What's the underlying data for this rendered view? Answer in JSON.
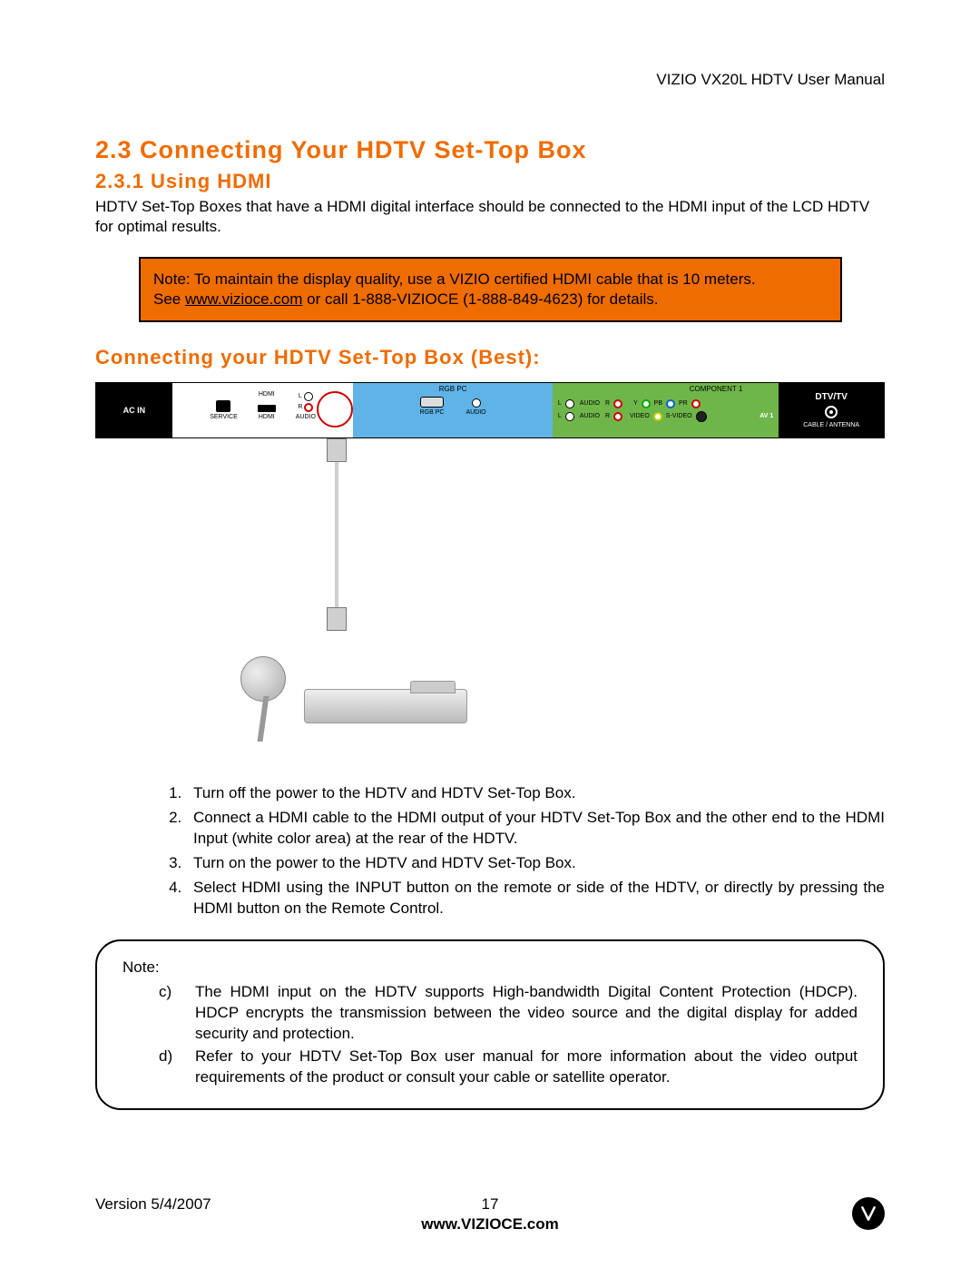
{
  "header": {
    "manual_title": "VIZIO VX20L HDTV User Manual"
  },
  "section": {
    "h1": "2.3 Connecting Your HDTV Set-Top Box",
    "h2": "2.3.1 Using HDMI",
    "intro": "HDTV Set-Top Boxes that have a HDMI digital interface should be connected to the HDMI input of the LCD HDTV for optimal results.",
    "note_box": {
      "line1": "Note: To maintain the display quality, use a VIZIO certified HDMI cable that is 10 meters.",
      "line2_pre": "See ",
      "link": "www.vizioce.com",
      "line2_post": " or call 1-888-VIZIOCE (1-888-849-4623) for details."
    },
    "h3": "Connecting your HDTV Set-Top Box (Best):"
  },
  "panel": {
    "ac_in": "AC IN",
    "service": "SERVICE",
    "hdmi_top": "HDMI",
    "hdmi_bot": "HDMI",
    "audio": "AUDIO",
    "l": "L",
    "r": "R",
    "rgb_pc_top": "RGB PC",
    "rgb_pc_bot": "RGB PC",
    "component1": "COMPONENT 1",
    "y": "Y",
    "pb": "PB",
    "pr": "PR",
    "video": "VIDEO",
    "svideo": "S-VIDEO",
    "av1": "AV 1",
    "dtvtv": "DTV/TV",
    "cable_ant": "CABLE / ANTENNA"
  },
  "steps": [
    "Turn off the power to the HDTV and HDTV Set-Top Box.",
    "Connect a HDMI cable to the HDMI output of your HDTV Set-Top Box and the other end to the HDMI Input (white color area) at the rear of the HDTV.",
    "Turn on the power to the HDTV and HDTV Set-Top Box.",
    "Select HDMI using the INPUT button on the remote or side of the HDTV, or directly by pressing the HDMI button on the Remote Control."
  ],
  "note2": {
    "title": "Note:",
    "items": [
      {
        "label": "c)",
        "text": "The HDMI input on the HDTV supports High-bandwidth Digital Content Protection (HDCP).  HDCP encrypts the transmission between the video source and the digital display for added security and protection."
      },
      {
        "label": "d)",
        "text": "Refer to your HDTV Set-Top Box user manual for more information about the video output requirements of the product or consult your cable or satellite operator."
      }
    ]
  },
  "footer": {
    "version": "Version 5/4/2007",
    "page": "17",
    "site": "www.VIZIOCE.com"
  }
}
